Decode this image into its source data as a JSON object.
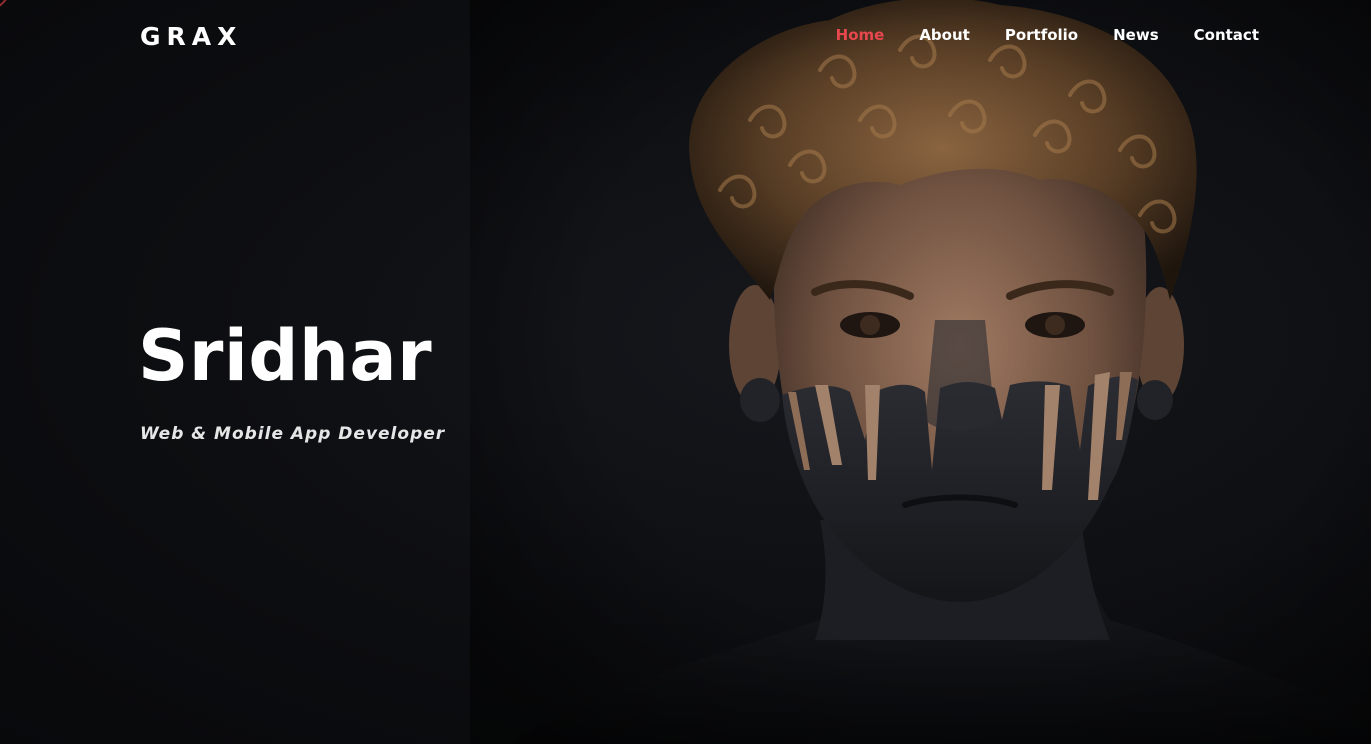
{
  "brand": {
    "logo_text": "GRAX"
  },
  "nav": {
    "items": [
      {
        "label": "Home",
        "active": true
      },
      {
        "label": "About",
        "active": false
      },
      {
        "label": "Portfolio",
        "active": false
      },
      {
        "label": "News",
        "active": false
      },
      {
        "label": "Contact",
        "active": false
      }
    ]
  },
  "hero": {
    "name": "Sridhar",
    "tagline": "Web & Mobile App Developer",
    "background_image": "portrait of man with curly hair and black face paint"
  },
  "colors": {
    "accent": "#e8474d",
    "background": "#0c0d10",
    "text": "#ffffff"
  }
}
